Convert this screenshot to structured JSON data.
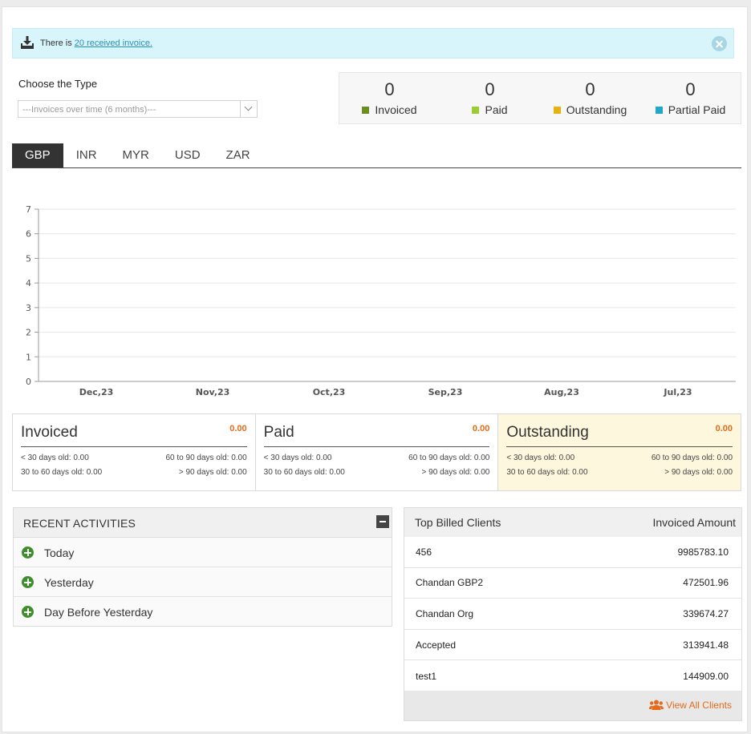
{
  "notice": {
    "prefix": "There is ",
    "link": "20 received invoice.",
    "icon": "download-icon",
    "close_icon": "close-icon"
  },
  "type_selector": {
    "label": "Choose the Type",
    "value": "---Invoices over time (6 months)---"
  },
  "summary": [
    {
      "value": "0",
      "label": "Invoiced",
      "color": "#6b8e1f"
    },
    {
      "value": "0",
      "label": "Paid",
      "color": "#9acd32"
    },
    {
      "value": "0",
      "label": "Outstanding",
      "color": "#e8b10e"
    },
    {
      "value": "0",
      "label": "Partial Paid",
      "color": "#1fa8c9"
    }
  ],
  "tabs": [
    "GBP",
    "INR",
    "MYR",
    "USD",
    "ZAR"
  ],
  "active_tab": "GBP",
  "chart_data": {
    "type": "bar",
    "categories": [
      "Dec,23",
      "Nov,23",
      "Oct,23",
      "Sep,23",
      "Aug,23",
      "Jul,23"
    ],
    "y_ticks": [
      "0",
      "1",
      "2",
      "3",
      "4",
      "5",
      "6",
      "7"
    ],
    "series": [
      {
        "values": [
          0,
          0,
          0,
          0,
          0,
          0
        ]
      }
    ],
    "ylim": [
      0,
      7
    ],
    "grid": true
  },
  "aging": [
    {
      "title": "Invoiced",
      "amount": "0.00",
      "lt30": "< 30 days old: 0.00",
      "d60_90": "60 to 90 days old: 0.00",
      "d30_60": "30 to 60 days old: 0.00",
      "gt90": "> 90 days old: 0.00"
    },
    {
      "title": "Paid",
      "amount": "0.00",
      "lt30": "< 30 days old: 0.00",
      "d60_90": "60 to 90 days old: 0.00",
      "d30_60": "30 to 60 days old: 0.00",
      "gt90": "> 90 days old: 0.00"
    },
    {
      "title": "Outstanding",
      "amount": "0.00",
      "lt30": "< 30 days old: 0.00",
      "d60_90": "60 to 90 days old: 0.00",
      "d30_60": "30 to 60 days old: 0.00",
      "gt90": "> 90 days old: 0.00"
    }
  ],
  "activities": {
    "title": "RECENT ACTIVITIES",
    "items": [
      "Today",
      "Yesterday",
      "Day Before Yesterday"
    ]
  },
  "clients": {
    "col_client": "Top Billed Clients",
    "col_amount": "Invoiced Amount",
    "rows": [
      {
        "name": "456",
        "amount": "9985783.10"
      },
      {
        "name": "Chandan GBP2",
        "amount": "472501.96"
      },
      {
        "name": "Chandan Org",
        "amount": "339674.27"
      },
      {
        "name": "Accepted",
        "amount": "313941.48"
      },
      {
        "name": "test1",
        "amount": "144909.00"
      }
    ],
    "view_all": "View All Clients",
    "view_icon": "users-icon"
  }
}
